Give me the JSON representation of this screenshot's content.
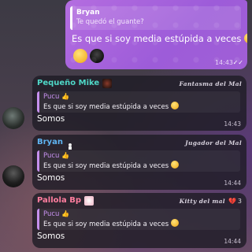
{
  "outgoing": {
    "reply_name": "Bryan",
    "reply_text": "Te quedó el guante?",
    "text": "Es que si soy media estúpida a veces",
    "time": "14:43",
    "read_checks": "✓✓"
  },
  "messages": [
    {
      "sender": "Pequeño Mike",
      "sender_color": "#4fd8c8",
      "title": "Fantasma del Mal",
      "reply_name": "Pucu",
      "reply_text": "Es que si soy media estúpida a veces",
      "text": "Somos",
      "time": "14:43",
      "extra": ""
    },
    {
      "sender": "Bryan",
      "sender_color": "#5fb4f2",
      "title": "Jugador del Mal",
      "reply_name": "Pucu",
      "reply_text": "Es que si soy media estúpida a veces",
      "text": "Somos",
      "time": "14:44",
      "extra": ""
    },
    {
      "sender": "Pallola Bp",
      "sender_color": "#ff7e9f",
      "title": "Kitty del mal",
      "reply_name": "Pucu",
      "reply_text": "Es que si soy media estúpida a veces",
      "text": "Somos",
      "time": "14:44",
      "extra": "3"
    }
  ],
  "colors": {
    "outgoing_bubble": "#a862dc",
    "incoming_bubble": "#1e1c26",
    "reply_accent": "#c690ee"
  },
  "icons": {
    "emoji": "smiling-emoji-icon",
    "hand": "thumbs-hand-icon",
    "double_check": "double-check-icon",
    "mute": "heart-break-icon"
  }
}
